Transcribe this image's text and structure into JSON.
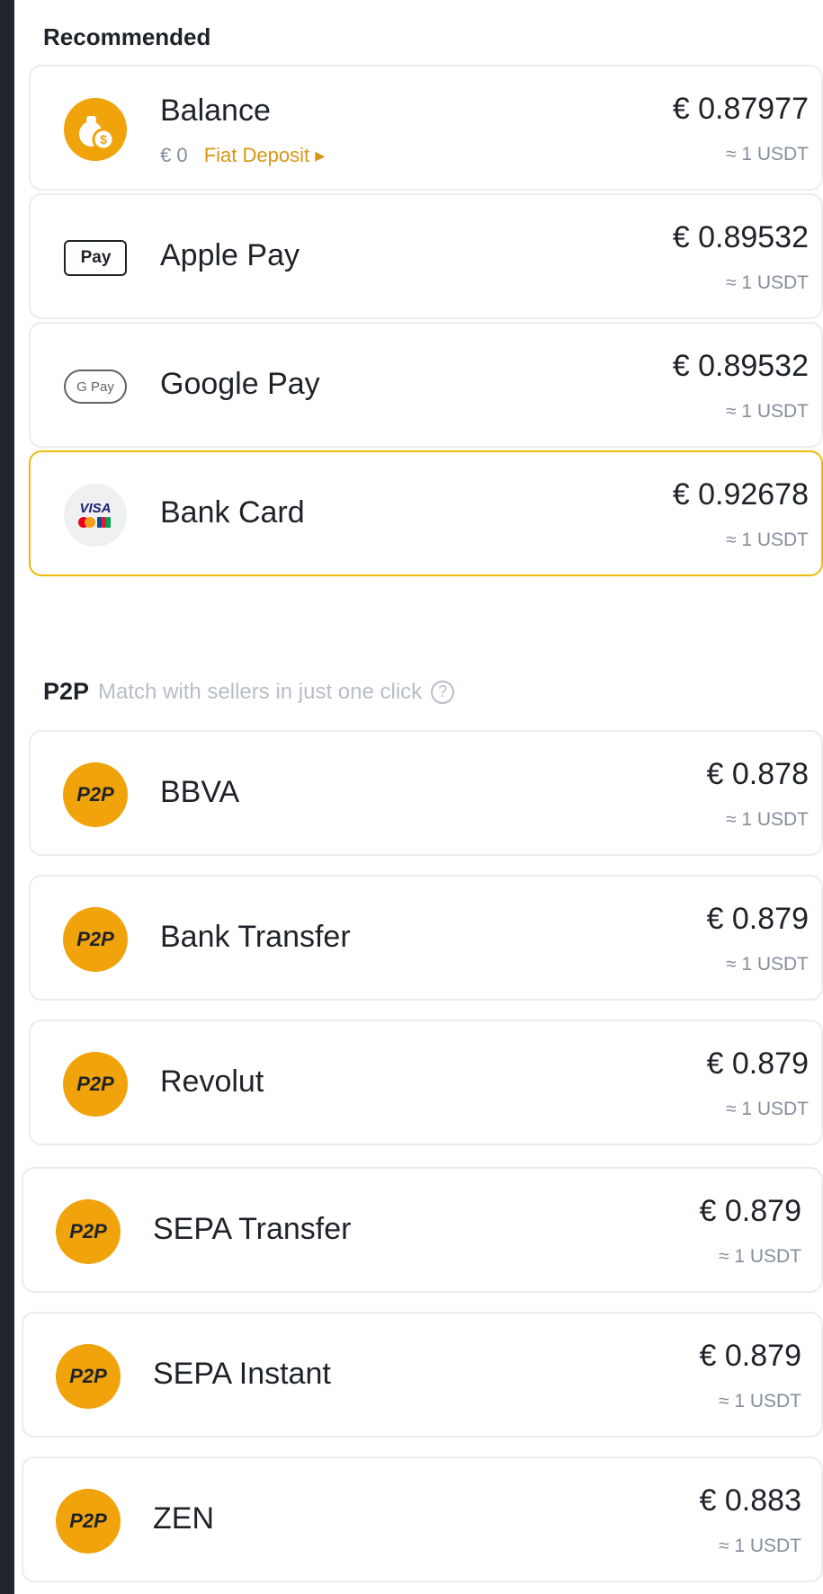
{
  "recommended": {
    "title": "Recommended",
    "items": [
      {
        "name": "Balance",
        "balance": "€ 0",
        "link": "Fiat Deposit ▸",
        "price": "€ 0.87977",
        "approx": "≈ 1 USDT",
        "icon": "coin-bag-icon"
      },
      {
        "name": "Apple Pay",
        "badge": "Pay",
        "price": "€ 0.89532",
        "approx": "≈ 1 USDT",
        "icon": "apple-pay-icon"
      },
      {
        "name": "Google Pay",
        "badge": "G Pay",
        "price": "€ 0.89532",
        "approx": "≈ 1 USDT",
        "icon": "google-pay-icon"
      },
      {
        "name": "Bank Card",
        "badge": "VISA",
        "price": "€ 0.92678",
        "approx": "≈ 1 USDT",
        "icon": "bank-card-icon",
        "selected": true
      }
    ]
  },
  "p2p": {
    "title": "P2P",
    "subtitle": "Match with sellers in just one click",
    "badge": "P2P",
    "items": [
      {
        "name": "BBVA",
        "price": "€ 0.878",
        "approx": "≈ 1 USDT"
      },
      {
        "name": "Bank Transfer",
        "price": "€ 0.879",
        "approx": "≈ 1 USDT"
      },
      {
        "name": "Revolut",
        "price": "€ 0.879",
        "approx": "≈ 1 USDT"
      },
      {
        "name": "SEPA Transfer",
        "price": "€ 0.879",
        "approx": "≈ 1 USDT"
      },
      {
        "name": "SEPA Instant",
        "price": "€ 0.879",
        "approx": "≈ 1 USDT"
      },
      {
        "name": "ZEN",
        "price": "€ 0.883",
        "approx": "≈ 1 USDT"
      }
    ]
  },
  "colors": {
    "accent": "#f0a30a",
    "selected_border": "#f0b90b",
    "link": "#d89614"
  }
}
